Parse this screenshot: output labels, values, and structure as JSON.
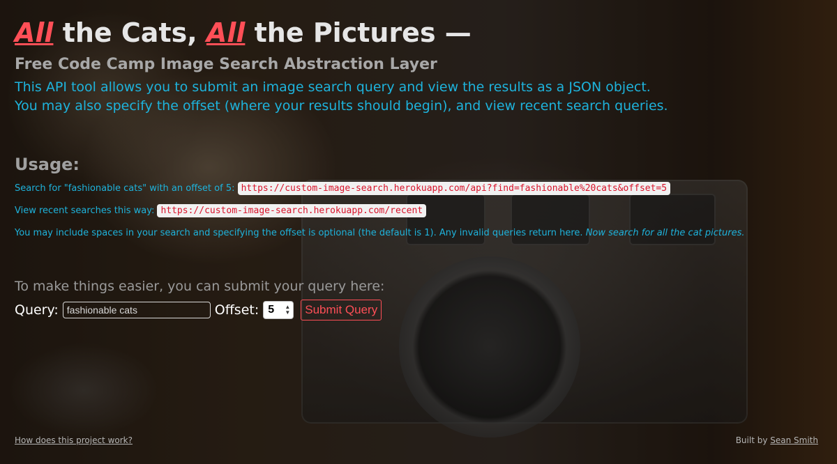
{
  "header": {
    "title_em_1": "All",
    "title_part_1": " the Cats, ",
    "title_em_2": "All",
    "title_part_2": " the Pictures —",
    "subtitle": "Free Code Camp Image Search Abstraction Layer",
    "intro_line_1": "This API tool allows you to submit an image search query and view the results as a JSON object.",
    "intro_line_2": "You may also specify the offset (where your results should begin), and view recent search queries."
  },
  "usage": {
    "heading": "Usage:",
    "search_label": "Search for \"fashionable cats\" with an offset of 5: ",
    "search_url": "https://custom-image-search.herokuapp.com/api?find=fashionable%20cats&offset=5",
    "recent_label": "View recent searches this way: ",
    "recent_url": "https://custom-image-search.herokuapp.com/recent",
    "note": "You may include spaces in your search and specifying the offset is optional (the default is 1). Any invalid queries return here. ",
    "note_em": "Now search for all the cat pictures."
  },
  "form": {
    "hint": "To make things easier, you can submit your query here:",
    "query_label": "Query:",
    "query_value": "fashionable cats",
    "offset_label": "Offset:",
    "offset_value": "5",
    "submit_label": "Submit Query"
  },
  "footer": {
    "how_link": "How does this project work?",
    "built_by": "Built by ",
    "author": "Sean Smith"
  },
  "colors": {
    "accent_red": "#ff4f57",
    "accent_blue": "#1eb3dc",
    "code_red": "#d8132a"
  }
}
